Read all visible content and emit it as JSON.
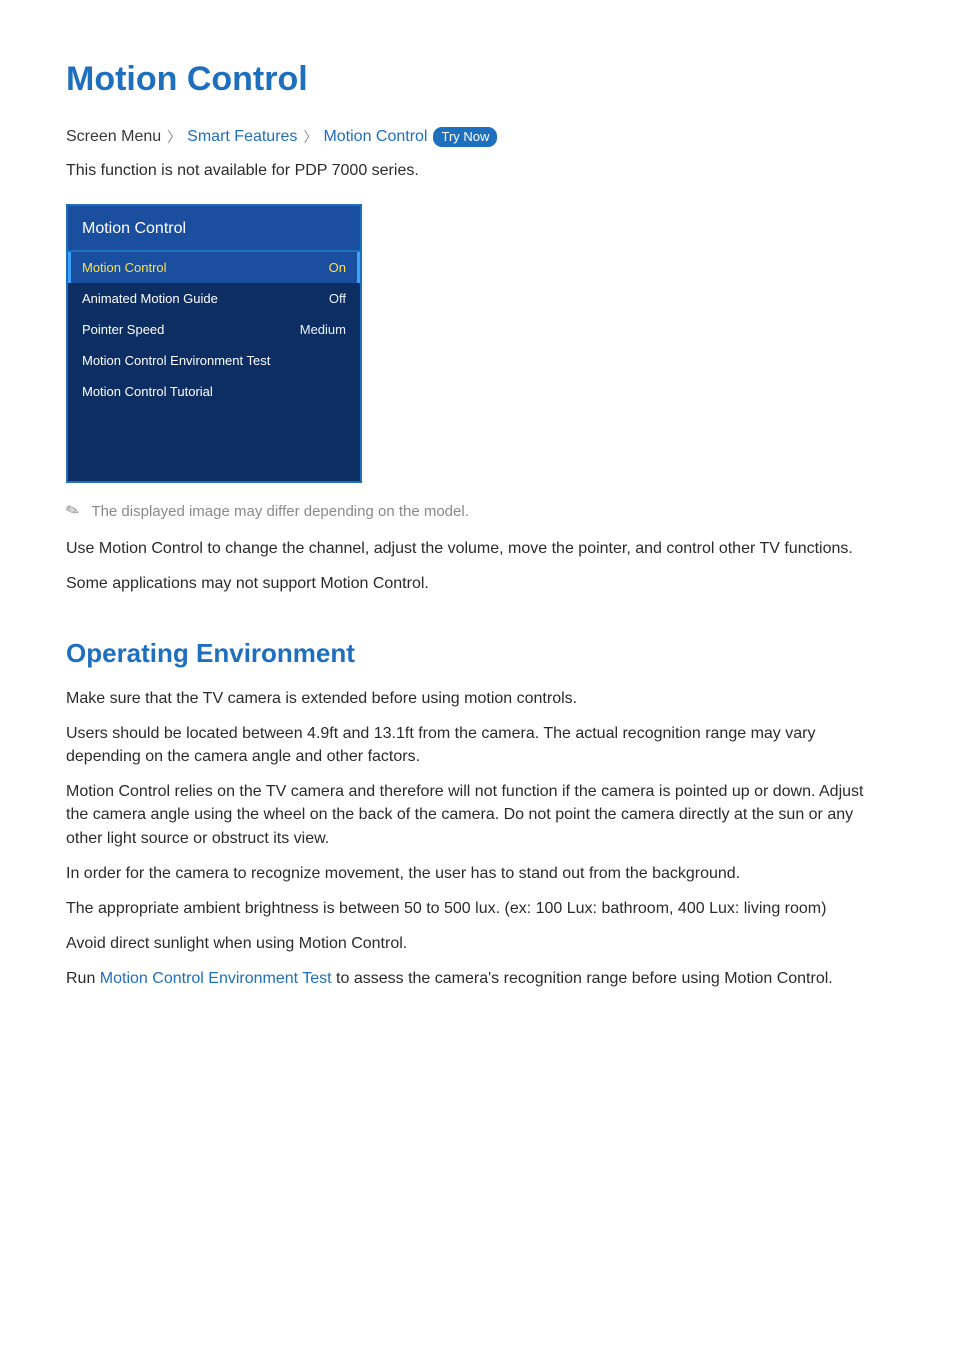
{
  "title": "Motion Control",
  "breadcrumb": {
    "prefix": "Screen Menu",
    "link1": "Smart Features",
    "link2": "Motion Control",
    "try_now": "Try Now"
  },
  "intro_note": "This function is not available for PDP 7000 series.",
  "panel": {
    "header": "Motion Control",
    "rows": [
      {
        "label": "Motion Control",
        "value": "On",
        "selected": true
      },
      {
        "label": "Animated Motion Guide",
        "value": "Off",
        "selected": false
      },
      {
        "label": "Pointer Speed",
        "value": "Medium",
        "selected": false
      },
      {
        "label": "Motion Control Environment Test",
        "value": "",
        "selected": false
      },
      {
        "label": "Motion Control Tutorial",
        "value": "",
        "selected": false
      }
    ]
  },
  "image_note": "The displayed image may differ depending on the model.",
  "desc1": "Use Motion Control to change the channel, adjust the volume, move the pointer, and control other TV functions.",
  "desc2": "Some applications may not support Motion Control.",
  "section2_title": "Operating Environment",
  "op_env": {
    "p1": "Make sure that the TV camera is extended before using motion controls.",
    "p2": "Users should be located between 4.9ft and 13.1ft from the camera. The actual recognition range may vary depending on the camera angle and other factors.",
    "p3": "Motion Control relies on the TV camera and therefore will not function if the camera is pointed up or down. Adjust the camera angle using the wheel on the back of the camera. Do not point the camera directly at the sun or any other light source or obstruct its view.",
    "p4": "In order for the camera to recognize movement, the user has to stand out from the background.",
    "p5": "The appropriate ambient brightness is between 50 to 500 lux. (ex: 100 Lux: bathroom, 400 Lux: living room)",
    "p6": "Avoid direct sunlight when using Motion Control.",
    "p7_pre": "Run ",
    "p7_link": "Motion Control Environment Test",
    "p7_post": " to assess the camera's recognition range before using Motion Control."
  }
}
